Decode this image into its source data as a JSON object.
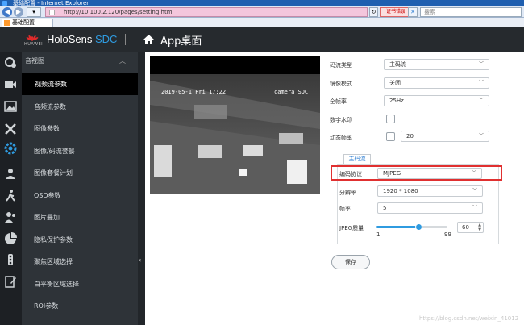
{
  "browser": {
    "title": "基础配置 - Internet Explorer",
    "url": "http://10.100.2.120/pages/setting.html",
    "cert_error": "证书错误",
    "search_placeholder": "搜索",
    "tab_label": "基础配置"
  },
  "header": {
    "logo_text": "HUAWEI",
    "brand_main": "HoloSens ",
    "brand_accent": "SDC",
    "app_title": "App桌面"
  },
  "sidebar": {
    "section": "音视图",
    "items": [
      {
        "label": "视频流参数",
        "active": true
      },
      {
        "label": "音频流参数"
      },
      {
        "label": "图像参数"
      },
      {
        "label": "图像/码流套餐"
      },
      {
        "label": "图像套餐计划"
      },
      {
        "label": "OSD参数"
      },
      {
        "label": "图片叠加"
      },
      {
        "label": "隐私保护参数"
      },
      {
        "label": "聚焦区域选择"
      },
      {
        "label": "白平衡区域选择"
      },
      {
        "label": "ROI参数"
      }
    ]
  },
  "video": {
    "osd_time": "2019-05-1 Fri 17:22",
    "osd_name": "camera SDC"
  },
  "form": {
    "stream_type_label": "码流类型",
    "stream_type_value": "主码流",
    "mirror_label": "镜像模式",
    "mirror_value": "关闭",
    "fullframe_label": "全帧率",
    "fullframe_value": "25Hz",
    "watermark_label": "数字水印",
    "dynamic_fps_label": "动态帧率",
    "dynamic_fps_value": "20",
    "subtab_label": "主码流",
    "codec_label": "编码协议",
    "codec_value": "MJPEG",
    "resolution_label": "分辨率",
    "resolution_value": "1920 * 1080",
    "fps_label": "帧率",
    "fps_value": "5",
    "jpeg_quality_label": "JPEG质量",
    "jpeg_quality_value": "60",
    "jpeg_min": "1",
    "jpeg_max": "99",
    "save_label": "保存"
  },
  "watermark": "https://blog.csdn.net/weixin_41012",
  "colors": {
    "accent": "#2f9be0",
    "highlight": "#e03030",
    "header_bg": "#262a2e",
    "menu_bg": "#2e3338"
  }
}
